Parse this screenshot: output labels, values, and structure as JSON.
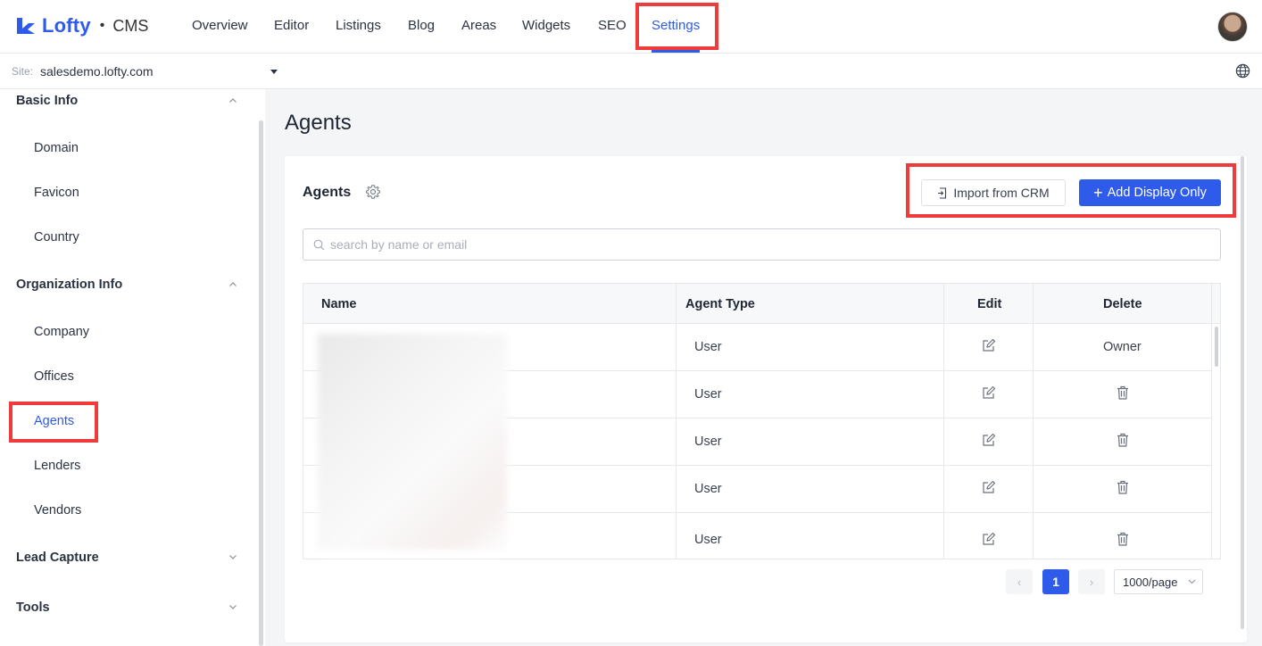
{
  "app": {
    "logo_text": "Lofty",
    "logo_dot": "•",
    "product": "CMS",
    "brand_color": "#2f5bea"
  },
  "nav": {
    "items": [
      {
        "label": "Overview"
      },
      {
        "label": "Editor"
      },
      {
        "label": "Listings"
      },
      {
        "label": "Blog"
      },
      {
        "label": "Areas"
      },
      {
        "label": "Widgets"
      },
      {
        "label": "SEO"
      },
      {
        "label": "Settings",
        "active": true
      }
    ]
  },
  "site": {
    "label": "Site:",
    "value": "salesdemo.lofty.com"
  },
  "sidebar": {
    "sections": [
      {
        "label": "Basic Info",
        "expanded": true,
        "items": [
          {
            "label": "Domain"
          },
          {
            "label": "Favicon"
          },
          {
            "label": "Country"
          }
        ]
      },
      {
        "label": "Organization Info",
        "expanded": true,
        "items": [
          {
            "label": "Company"
          },
          {
            "label": "Offices"
          },
          {
            "label": "Agents",
            "active": true
          },
          {
            "label": "Lenders"
          },
          {
            "label": "Vendors"
          }
        ]
      },
      {
        "label": "Lead Capture",
        "expanded": false,
        "items": []
      },
      {
        "label": "Tools",
        "expanded": false,
        "items": []
      }
    ]
  },
  "main": {
    "page_title": "Agents",
    "card_title": "Agents",
    "import_button": "Import from CRM",
    "add_button": "Add Display Only",
    "search_placeholder": "search by name or email",
    "table": {
      "headers": [
        "Name",
        "Agent Type",
        "Edit",
        "Delete"
      ],
      "rows": [
        {
          "type": "User",
          "delete": "Owner"
        },
        {
          "type": "User",
          "delete": "trash-icon"
        },
        {
          "type": "User",
          "delete": "trash-icon"
        },
        {
          "type": "User",
          "delete": "trash-icon"
        },
        {
          "type": "User",
          "delete": "trash-icon"
        }
      ]
    },
    "pagination": {
      "prev": "‹",
      "current": "1",
      "next": "›",
      "page_size": "1000/page"
    }
  }
}
